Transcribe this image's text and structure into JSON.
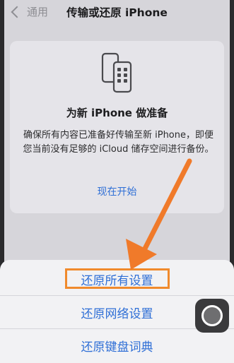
{
  "nav": {
    "back_label": "通用",
    "title": "传输或还原 iPhone"
  },
  "card": {
    "icon": "iphone-transfer-icon",
    "title": "为新 iPhone 做准备",
    "description": "确保所有内容已准备好传输至新 iPhone，即便您当前没有足够的 iCloud 储存空间进行备份。",
    "link_label": "现在开始"
  },
  "action_sheet": {
    "items": [
      {
        "label": "还原所有设置",
        "highlighted": true
      },
      {
        "label": "还原网络设置"
      },
      {
        "label": "还原键盘词典"
      }
    ]
  },
  "annotation": {
    "arrow_color": "#f07a2a",
    "highlight_color": "#f08a2c"
  },
  "colors": {
    "accent": "#2f6fd6",
    "background": "#d6d5da",
    "card": "#e5e4e9",
    "sheet": "#f2f2f4"
  }
}
